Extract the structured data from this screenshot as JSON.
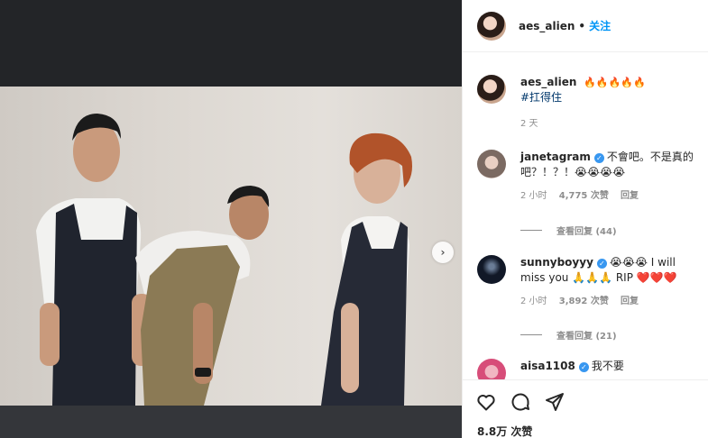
{
  "header": {
    "username": "aes_alien",
    "separator": "•",
    "follow_label": "关注"
  },
  "caption": {
    "username": "aes_alien",
    "emojis": "🔥🔥🔥🔥🔥",
    "hashtag": "#扛得住",
    "time": "2 天"
  },
  "comments": [
    {
      "username": "janetagram",
      "verified": true,
      "text": "不會吧。不是真的吧？！？！😭😭😭😭",
      "time": "2 小时",
      "likes": "4,775 次赞",
      "reply": "回复",
      "view_replies": "查看回复 (44)"
    },
    {
      "username": "sunnyboyyy",
      "verified": true,
      "text": "😭😭😭 I will miss you 🙏🙏🙏 RIP ❤️❤️❤️",
      "time": "2 小时",
      "likes": "3,892 次赞",
      "reply": "回复",
      "view_replies": "查看回复 (21)"
    },
    {
      "username": "aisa1108",
      "verified": true,
      "text": "我不要"
    }
  ],
  "actions": {
    "like_count": "8.8万 次赞"
  },
  "icons": {
    "like": "heart-icon",
    "comment": "comment-icon",
    "share": "share-icon",
    "next": "chevron-right-icon"
  },
  "colors": {
    "accent": "#0095f6",
    "verified": "#3897f0",
    "muted": "#8e8e8e"
  }
}
